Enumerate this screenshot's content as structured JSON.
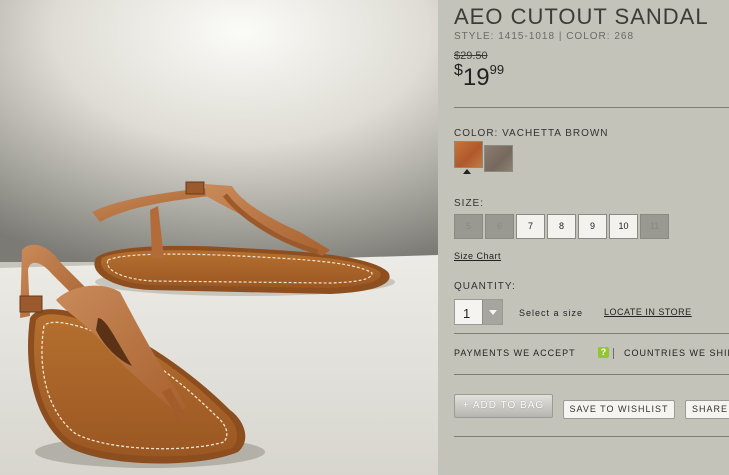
{
  "product": {
    "title": "AEO CUTOUT SANDAL",
    "style_line": "STYLE: 1415-1018 | COLOR: 268",
    "original_price": "$29.50",
    "price_currency": "$",
    "price_dollars": "19",
    "price_cents": "99"
  },
  "color": {
    "label": "COLOR: VACHETTA BROWN",
    "swatches": [
      {
        "name": "vachetta-brown",
        "color": "#b8622f",
        "selected": true
      },
      {
        "name": "taupe",
        "color": "#807266",
        "selected": false
      }
    ]
  },
  "size": {
    "label": "SIZE:",
    "options": [
      {
        "value": "5",
        "available": false
      },
      {
        "value": "6",
        "available": false
      },
      {
        "value": "7",
        "available": true
      },
      {
        "value": "8",
        "available": true
      },
      {
        "value": "9",
        "available": true
      },
      {
        "value": "10",
        "available": true
      },
      {
        "value": "11",
        "available": false
      }
    ],
    "chart_link": "Size Chart"
  },
  "quantity": {
    "label": "QUANTITY:",
    "value": "1",
    "hint": "Select a size",
    "locate_link": "LOCATE IN STORE"
  },
  "payments": {
    "label": "PAYMENTS WE ACCEPT",
    "help_icon": "?",
    "countries_label": "COUNTRIES WE SHIP"
  },
  "actions": {
    "add_to_bag": "+ ADD TO BAG",
    "save_to_wishlist": "SAVE TO WISHLIST",
    "share": "SHARE"
  },
  "colors": {
    "panel_bg": "#c4c3b9",
    "help_badge": "#93c532"
  }
}
